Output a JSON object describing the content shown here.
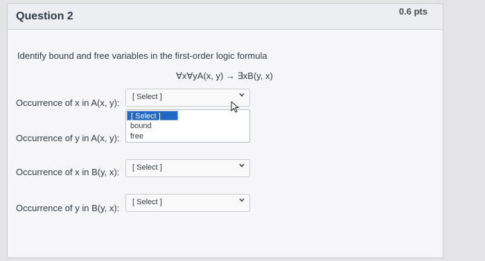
{
  "question": {
    "title": "Question 2",
    "points": "0.6 pts",
    "prompt": "Identify bound and free variables in the first-order logic formula",
    "formula": "∀x∀yA(x, y) → ∃xB(y, x)"
  },
  "rows": [
    {
      "label": "Occurrence of x in A(x, y):",
      "selected": "[ Select ]"
    },
    {
      "label": "Occurrence of y in A(x, y):",
      "selected": "[ Select ]"
    },
    {
      "label": "Occurrence of x in B(y, x):",
      "selected": "[ Select ]"
    },
    {
      "label": "Occurrence of y in B(y, x):",
      "selected": "[ Select ]"
    }
  ],
  "dropdown": {
    "options": [
      "[ Select ]",
      "bound",
      "free"
    ],
    "highlighted": "[ Select ]"
  },
  "icons": {
    "chevron": "chevron-down-icon",
    "cursor": "mouse-pointer-icon"
  }
}
